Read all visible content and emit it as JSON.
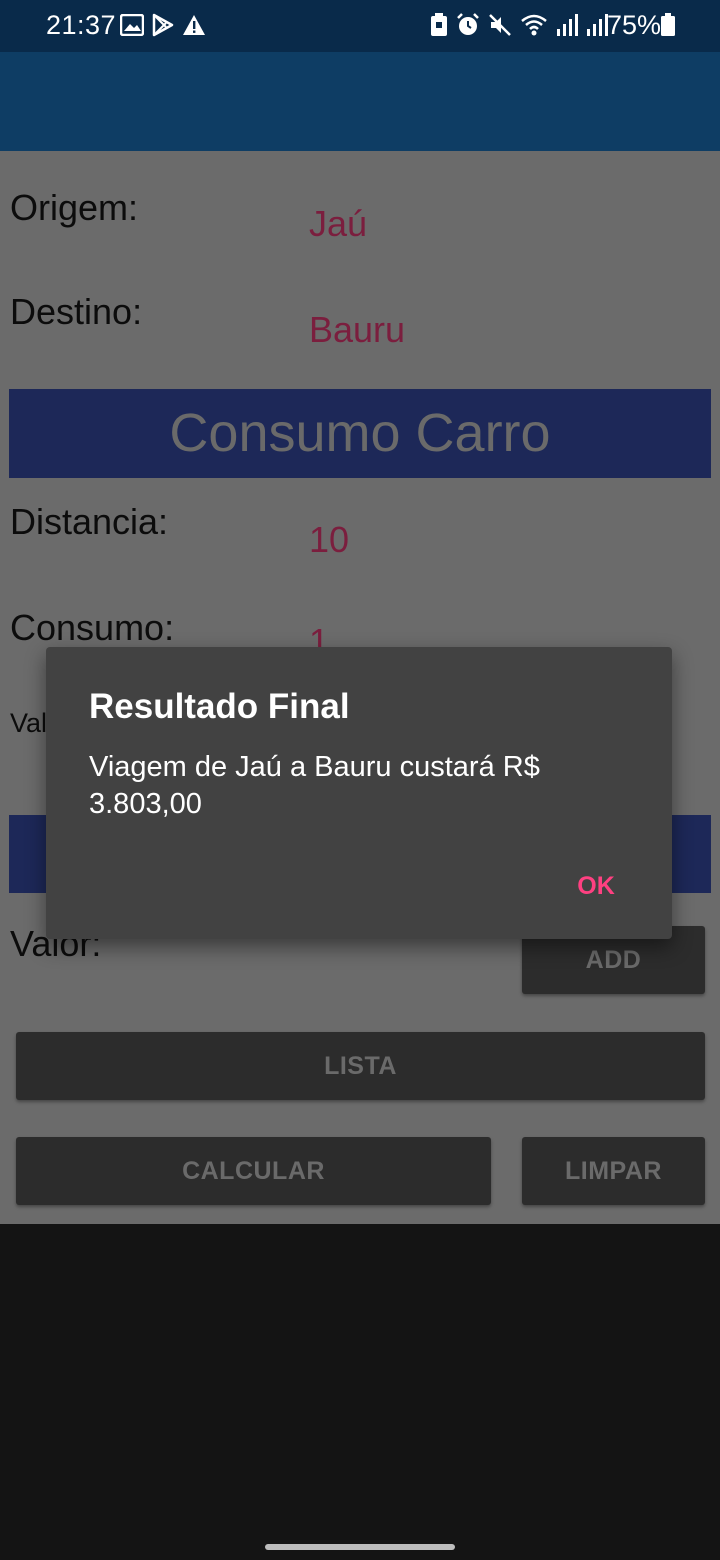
{
  "status_bar": {
    "time": "21:37",
    "battery": "75%",
    "left_icons": [
      "image-icon",
      "play-store-icon",
      "warning-icon"
    ],
    "right_icons": [
      "battery-saver-icon",
      "alarm-icon",
      "mute-icon",
      "wifi-icon",
      "signal-icon",
      "signal-icon",
      "battery-icon"
    ]
  },
  "form": {
    "origem_label": "Origem:",
    "origem_value": "Jaú",
    "destino_label": "Destino:",
    "destino_value": "Bauru",
    "section_title": "Consumo Carro",
    "distancia_label": "Distancia:",
    "distancia_value": "10",
    "consumo_label": "Consumo:",
    "consumo_value": "1",
    "partial_label": "Val",
    "valor_label": "Valor:"
  },
  "buttons": {
    "add": "ADD",
    "lista": "LISTA",
    "calcular": "CALCULAR",
    "limpar": "LIMPAR"
  },
  "dialog": {
    "title": "Resultado Final",
    "message": "Viagem de Jaú a Bauru custará R$ 3.803,00",
    "ok": "OK"
  },
  "colors": {
    "status_bar": "#092a4a",
    "app_bar": "#0e3d64",
    "banner": "#1d2858",
    "value_text": "#7b1e3e",
    "dialog_bg": "#424242",
    "accent": "#ff4081"
  }
}
